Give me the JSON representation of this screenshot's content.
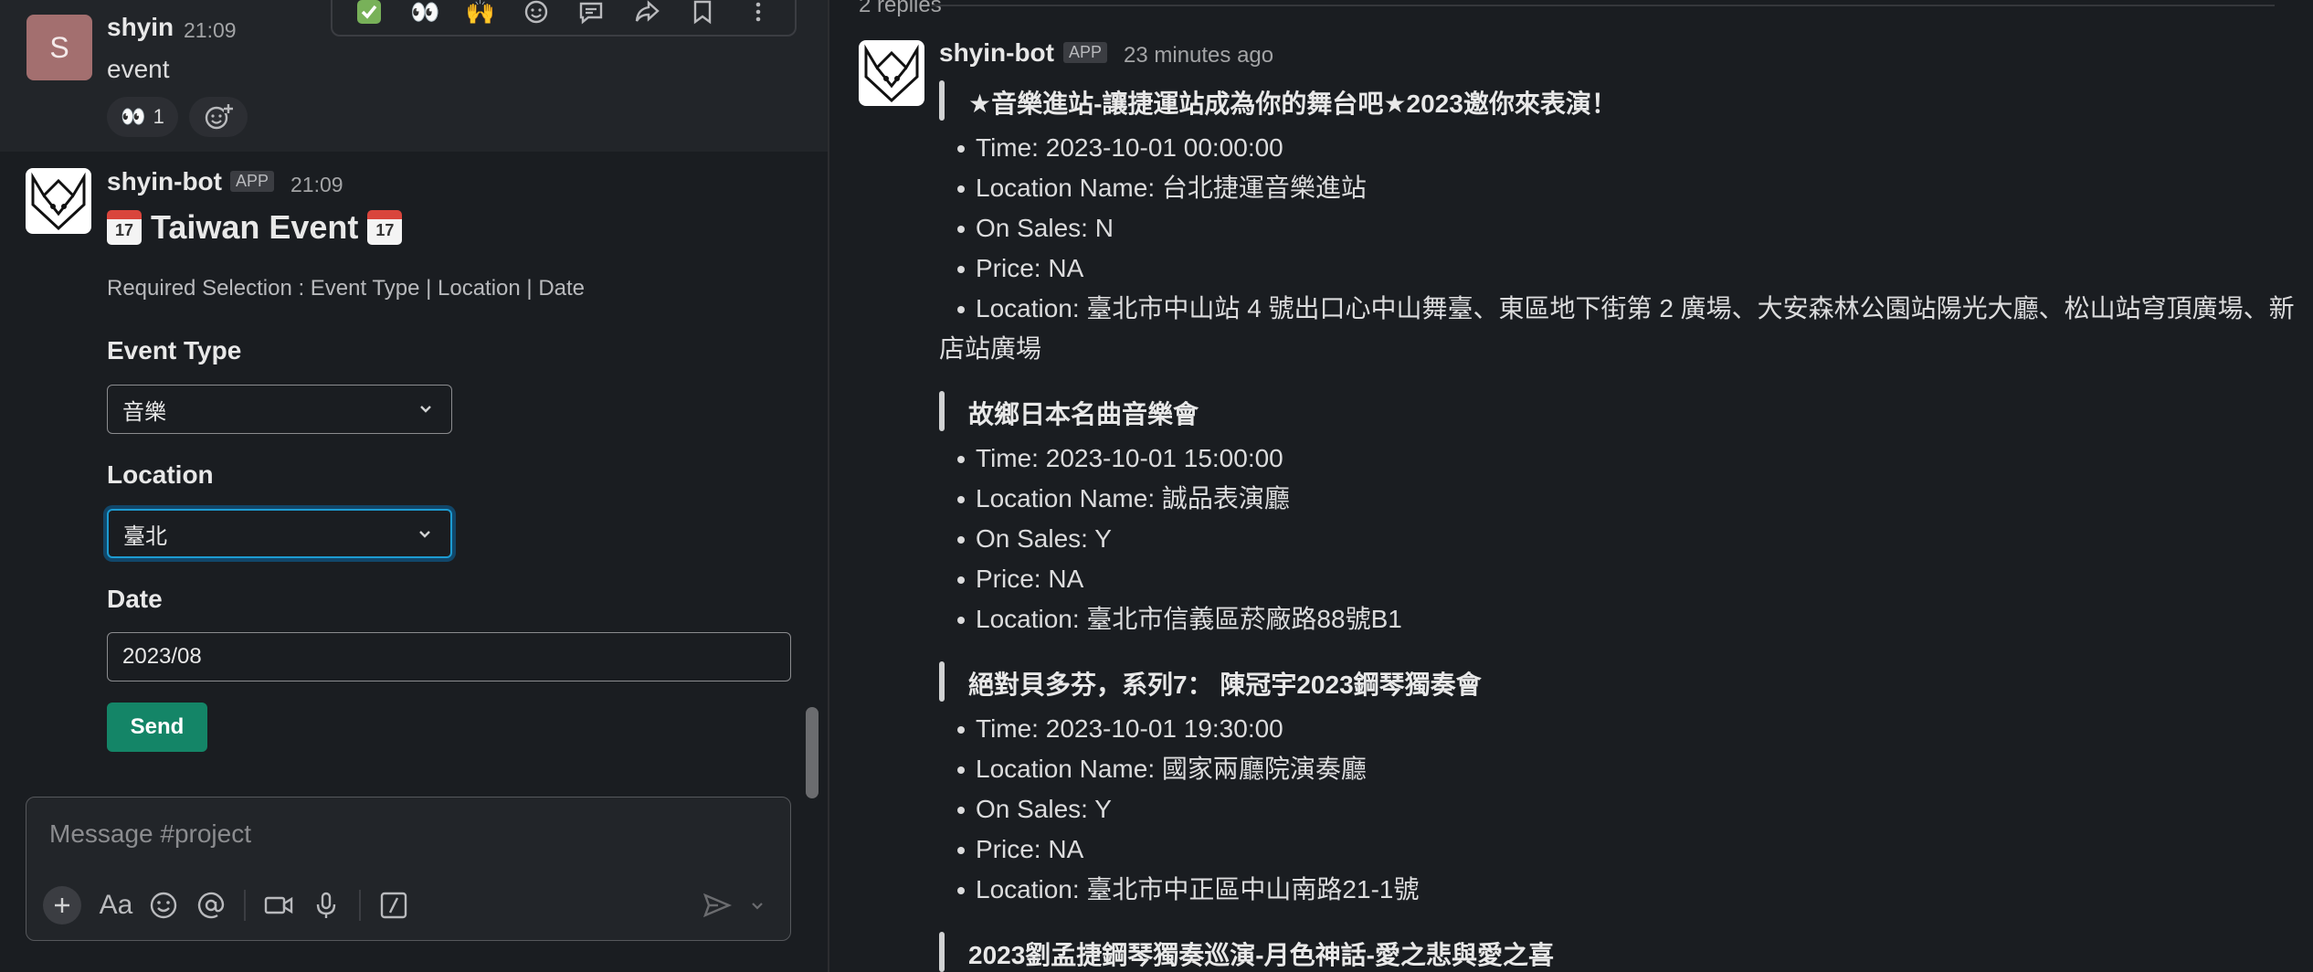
{
  "left": {
    "message1": {
      "avatar_letter": "S",
      "author": "shyin",
      "time": "21:09",
      "text": "event",
      "reaction": {
        "emoji": "👀",
        "count": "1"
      }
    },
    "hover_toolbar": [
      "check-mark-icon",
      "eyes-icon",
      "raised-hands-icon",
      "add-reaction-icon",
      "reply-icon",
      "forward-icon",
      "bookmark-icon",
      "more-icon"
    ],
    "message2": {
      "author": "shyin-bot",
      "badge": "APP",
      "time": "21:09",
      "title": "Taiwan Event",
      "required": "Required Selection : Event Type | Location | Date",
      "event_type_label": "Event Type",
      "event_type_value": "音樂",
      "location_label": "Location",
      "location_value": "臺北",
      "date_label": "Date",
      "date_value": "2023/08",
      "send_label": "Send"
    },
    "composer": {
      "placeholder": "Message #project",
      "format_label": "Aa"
    }
  },
  "right": {
    "replies": "2 replies",
    "author": "shyin-bot",
    "badge": "APP",
    "time": "23 minutes ago",
    "events": [
      {
        "title": "★音樂進站-讓捷運站成為你的舞台吧★2023邀你來表演！",
        "time": "Time:  2023-10-01 00:00:00",
        "location_name": "Location Name: 台北捷運音樂進站",
        "on_sales": "On Sales: N",
        "price": "Price: NA",
        "location": "Location: 臺北市中山站 4 號出口心中山舞臺、東區地下街第 2 廣場、大安森林公園站陽光大廳、松山站穹頂廣場、新店站廣場"
      },
      {
        "title": "故鄉日本名曲音樂會",
        "time": "Time:  2023-10-01 15:00:00",
        "location_name": "Location Name: 誠品表演廳",
        "on_sales": "On Sales: Y",
        "price": "Price: NA",
        "location": "Location: 臺北市信義區菸廠路88號B1"
      },
      {
        "title": "絕對貝多芬，系列7： 陳冠宇2023鋼琴獨奏會",
        "time": "Time:  2023-10-01 19:30:00",
        "location_name": "Location Name: 國家兩廳院演奏廳",
        "on_sales": "On Sales: Y",
        "price": "Price: NA",
        "location": "Location: 臺北市中正區中山南路21-1號"
      },
      {
        "title": "2023劉孟捷鋼琴獨奏巡演-月色神話-愛之悲與愛之喜"
      }
    ]
  }
}
